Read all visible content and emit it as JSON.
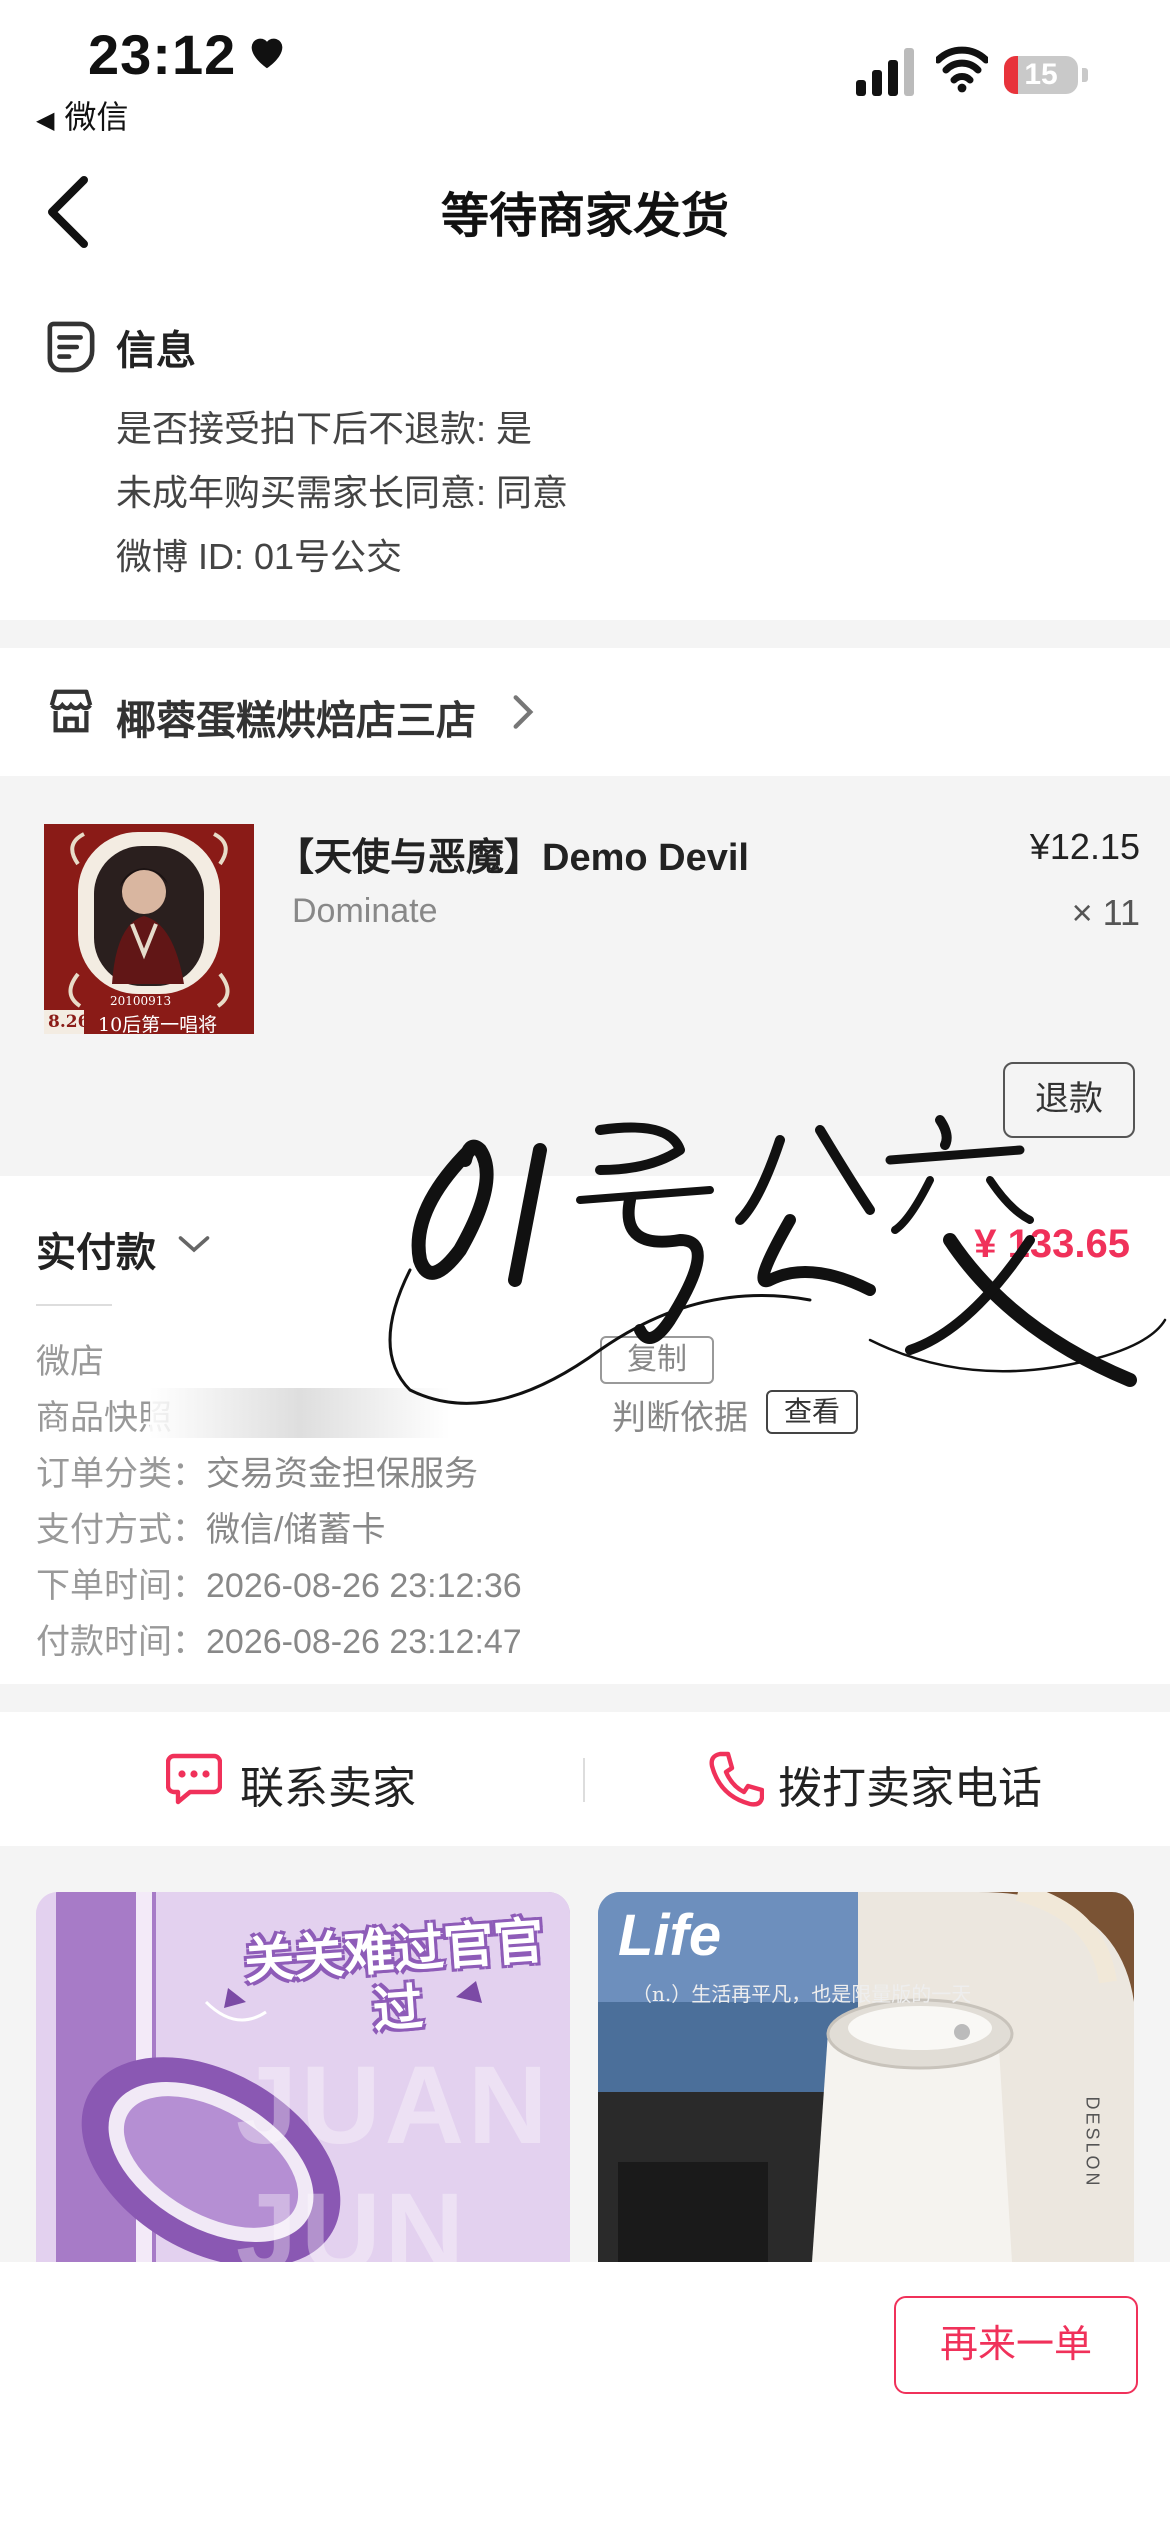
{
  "status_bar": {
    "time": "23:12",
    "back_app": "微信",
    "battery": "15",
    "icons": [
      "heart-icon",
      "signal-icon",
      "wifi-icon",
      "battery-icon"
    ]
  },
  "nav": {
    "title": "等待商家发货"
  },
  "info": {
    "title": "信息",
    "lines": [
      "是否接受拍下后不退款: 是",
      "未成年购买需家长同意: 同意",
      "微博 ID: 01号公交"
    ]
  },
  "shop": {
    "name": "椰蓉蛋糕烘焙店三店"
  },
  "product": {
    "title": "【天使与恶魔】Demo Devil",
    "sku": "Dominate",
    "price": "¥12.15",
    "qty": "× 11",
    "refund_label": "退款",
    "thumb_date": "8.26",
    "thumb_caption": "10后第一唱将",
    "thumb_small": "20100913"
  },
  "payment": {
    "label": "实付款",
    "amount": "¥ 133.65",
    "rows": [
      {
        "key": "微店",
        "value": ""
      },
      {
        "key": "商品快照",
        "value": "判断依据"
      },
      {
        "key": "订单分类：",
        "value": "交易资金担保服务"
      },
      {
        "key": "支付方式：",
        "value": "微信/储蓄卡"
      },
      {
        "key": "下单时间：",
        "value": "2026-08-26 23:12:36"
      },
      {
        "key": "付款时间：",
        "value": "2026-08-26 23:12:47"
      }
    ],
    "copy_label": "复制",
    "view_label": "查看"
  },
  "contact": {
    "seller": "联系卖家",
    "phone": "拨打卖家电话"
  },
  "recommend": [
    {
      "title": "关关难过官官过",
      "bg_text": "JUAN JUN"
    },
    {
      "title": "Life",
      "subtitle": "（n.）生活再平凡，也是限量版的一天",
      "brand": "DESLON"
    }
  ],
  "bottom": {
    "again_label": "再来一单"
  },
  "overlay": {
    "signature": "01号公交"
  },
  "colors": {
    "accent": "#f0315a",
    "page_bg": "#f4f4f4",
    "card_bg": "#ffffff"
  }
}
